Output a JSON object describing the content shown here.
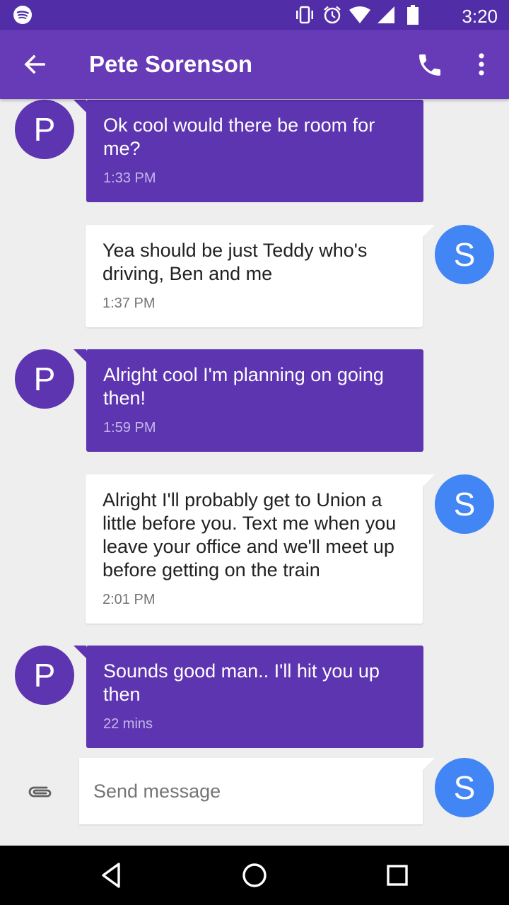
{
  "status_bar": {
    "time": "3:20",
    "icons": [
      "spotify-icon",
      "vibrate-icon",
      "alarm-icon",
      "wifi-icon",
      "signal-icon",
      "battery-icon"
    ]
  },
  "app_bar": {
    "title": "Pete Sorenson",
    "icons": [
      "back-arrow-icon",
      "phone-icon",
      "more-vert-icon"
    ],
    "color": "#673ab7"
  },
  "conversation": {
    "messages": [
      {
        "direction": "in",
        "avatar": "P",
        "text": "Ok cool would there be room for me?",
        "time": "1:33 PM"
      },
      {
        "direction": "out",
        "avatar": "S",
        "text": "Yea should be just Teddy who's driving, Ben and me",
        "time": "1:37 PM"
      },
      {
        "direction": "in",
        "avatar": "P",
        "text": "Alright cool I'm planning on going then!",
        "time": "1:59 PM"
      },
      {
        "direction": "out",
        "avatar": "S",
        "text": "Alright I'll probably get to Union a little before you. Text me when you leave your office and we'll meet up before getting on the train",
        "time": "2:01 PM"
      },
      {
        "direction": "in",
        "avatar": "P",
        "text": "Sounds good man.. I'll hit you up then",
        "time": "22 mins"
      }
    ]
  },
  "compose": {
    "placeholder": "Send message",
    "value": "",
    "avatar": "S",
    "icon": "paperclip-icon"
  },
  "nav_bar": {
    "icons": [
      "back-triangle-icon",
      "home-circle-icon",
      "recents-square-icon"
    ]
  },
  "colors": {
    "incoming_bubble": "#5e35b1",
    "outgoing_avatar": "#4285f4",
    "background": "#eeeeee"
  }
}
